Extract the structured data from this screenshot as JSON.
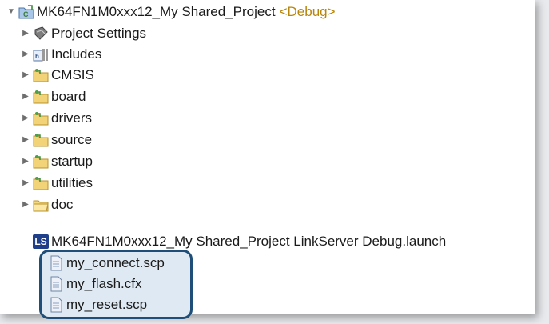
{
  "project": {
    "name": "MK64FN1M0xxx12_My Shared_Project",
    "config": "<Debug>"
  },
  "tree_items": [
    {
      "label": "Project Settings",
      "icon": "settings-book-icon"
    },
    {
      "label": "Includes",
      "icon": "includes-icon"
    },
    {
      "label": "CMSIS",
      "icon": "source-folder-icon"
    },
    {
      "label": "board",
      "icon": "source-folder-icon"
    },
    {
      "label": "drivers",
      "icon": "source-folder-icon"
    },
    {
      "label": "source",
      "icon": "source-folder-icon"
    },
    {
      "label": "startup",
      "icon": "source-folder-icon"
    },
    {
      "label": "utilities",
      "icon": "source-folder-icon"
    },
    {
      "label": "doc",
      "icon": "folder-icon"
    }
  ],
  "launch_file": {
    "badge": "LS",
    "label": "MK64FN1M0xxx12_My Shared_Project LinkServer Debug.launch"
  },
  "script_files": [
    {
      "label": "my_connect.scp",
      "icon": "file-icon"
    },
    {
      "label": "my_flash.cfx",
      "icon": "file-icon"
    },
    {
      "label": "my_reset.scp",
      "icon": "file-icon"
    }
  ],
  "colors": {
    "highlight_border": "#1f4e79",
    "highlight_fill": "#dfe9f3",
    "debug_config": "#b8860b"
  }
}
